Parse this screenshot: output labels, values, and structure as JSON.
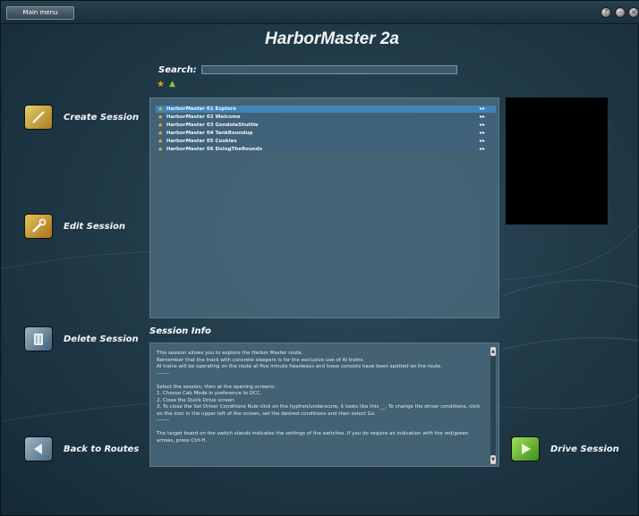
{
  "topbar": {
    "main_menu_label": "Main menu",
    "controls": [
      "help-icon",
      "minimize-icon",
      "close-icon"
    ]
  },
  "header": {
    "title": "HarborMaster 2a"
  },
  "search": {
    "label": "Search:",
    "value": "",
    "placeholder": ""
  },
  "filters": [
    "star-filter-icon",
    "triangle-filter-icon"
  ],
  "sidebar": {
    "create_label": "Create Session",
    "edit_label": "Edit Session",
    "delete_label": "Delete Session",
    "back_label": "Back to Routes"
  },
  "sessions": [
    {
      "name": "HarborMaster 01 Explore",
      "selected": true
    },
    {
      "name": "HarborMaster 02 Welcome",
      "selected": false
    },
    {
      "name": "HarborMaster 03 GondolaShuttle",
      "selected": false
    },
    {
      "name": "HarborMaster 04 TankRoundup",
      "selected": false
    },
    {
      "name": "HarborMaster 05 Cookies",
      "selected": false
    },
    {
      "name": "HarborMaster 06 DoingTheRounds",
      "selected": false
    }
  ],
  "session_info": {
    "label": "Session Info",
    "lines": [
      "This session allows you to explore the Harbor Master route.",
      "Remember that the track with concrete sleepers is for the exclusive use of AI trains.",
      "AI trains will be operating on the route at five minute headways and loose consists have been spotted on the route.",
      "-------",
      "",
      "Select the session, then at the opening screens:",
      "1. Choose Cab Mode in preference to DCC.",
      "2. Close the Quick Drive screen.",
      "3. To close the Set Driver Conditions Rule click on the hyphen/underscore, it looks like this __. To change the driver conditions, click on the icon in the upper left of the screen, set the desired conditions and then select Go.",
      "-------",
      "",
      "The target board on the switch stands indicates the settings of the switches. If you do require an indication with the red/green arrows, press Ctrl-H."
    ]
  },
  "drive": {
    "label": "Drive Session"
  },
  "colors": {
    "accent_blue": "#3f85b8",
    "star": "#f2b431",
    "green": "#8fbf3c"
  }
}
